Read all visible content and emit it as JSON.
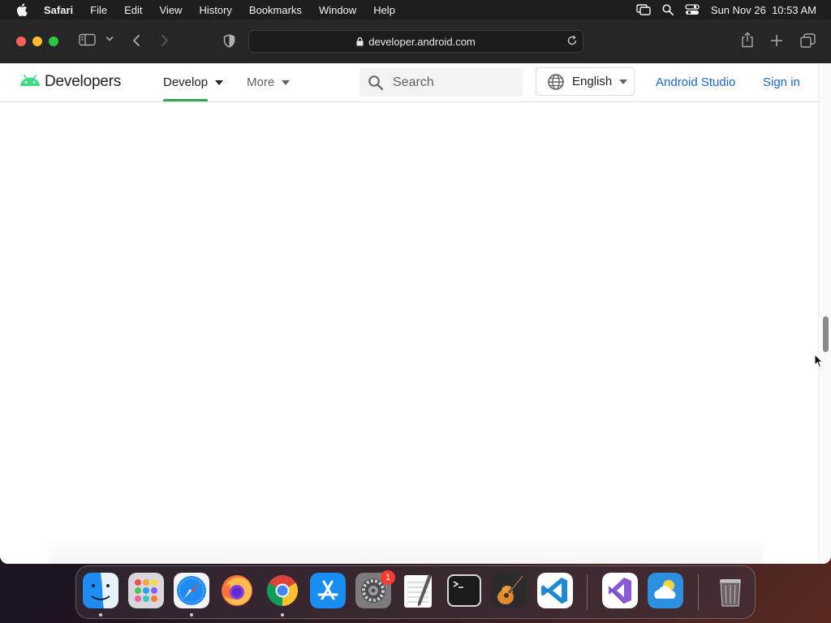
{
  "menubar": {
    "app": "Safari",
    "items": [
      "File",
      "Edit",
      "View",
      "History",
      "Bookmarks",
      "Window",
      "Help"
    ],
    "datetime": "Sun Nov 26  10:53 AM"
  },
  "browser": {
    "url": "developer.android.com"
  },
  "site": {
    "logo_text": "Developers",
    "nav": [
      {
        "label": "Develop",
        "active": true
      },
      {
        "label": "More",
        "active": false
      }
    ],
    "search_placeholder": "Search",
    "language": "English",
    "android_studio": "Android Studio",
    "sign_in": "Sign in"
  },
  "dock": {
    "apps": [
      "finder-icon",
      "launchpad-icon",
      "safari-icon",
      "firefox-icon",
      "chrome-icon",
      "app-store-icon",
      "system-settings-icon",
      "textedit-icon",
      "terminal-icon",
      "garageband-icon",
      "vscode-icon",
      "visual-studio-icon",
      "weather-icon",
      "trash-icon"
    ],
    "settings_badge": "1"
  },
  "colors": {
    "accent_green": "#34a853",
    "link_blue": "#1967d2",
    "android_green": "#3ddc84"
  }
}
